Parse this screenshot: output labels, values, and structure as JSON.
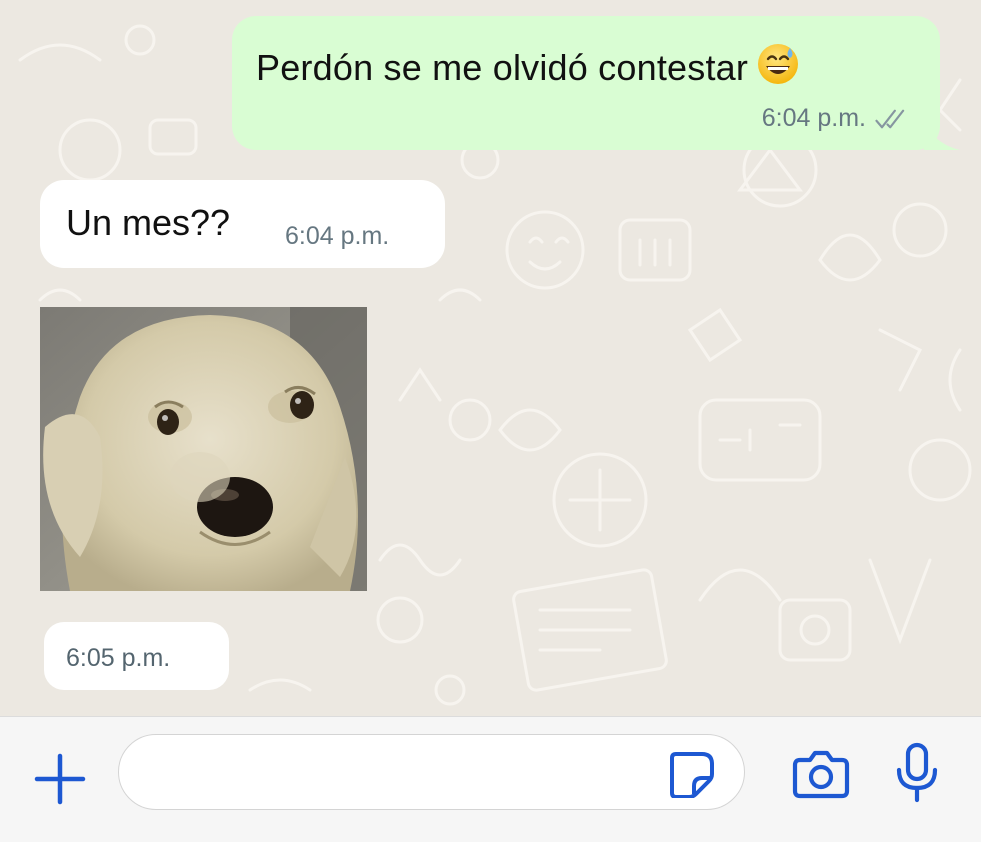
{
  "colors": {
    "outgoing_bubble": "#d9fdd3",
    "incoming_bubble": "#ffffff",
    "accent": "#1d58d2",
    "chat_background": "#ece8e1",
    "meta_text": "#667781"
  },
  "messages": [
    {
      "direction": "outgoing",
      "text": "Perdón se me olvidó contestar",
      "emoji": "grinning-face-with-sweat",
      "time": "6:04 p.m.",
      "status": "delivered-double-check"
    },
    {
      "direction": "incoming",
      "text": "Un mes??",
      "time": "6:04 p.m."
    },
    {
      "direction": "incoming",
      "type": "sticker",
      "sticker": "sad-puppy-face",
      "time": "6:05 p.m."
    }
  ],
  "composer": {
    "placeholder": "",
    "value": "",
    "icons": {
      "attach": "plus-icon",
      "sticker": "sticker-icon",
      "camera": "camera-icon",
      "voice": "microphone-icon"
    }
  }
}
